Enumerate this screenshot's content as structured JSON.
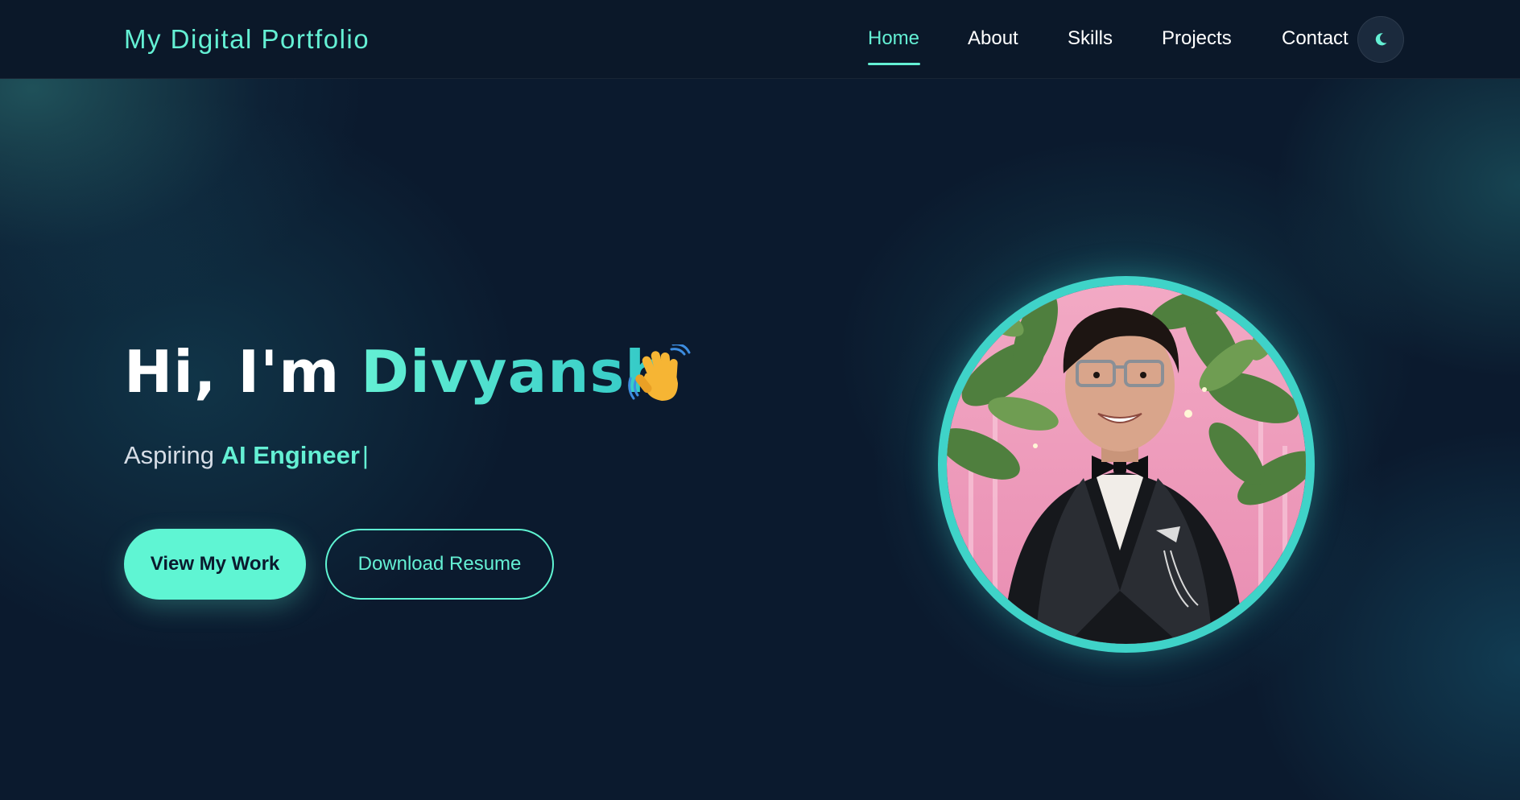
{
  "brand": {
    "title": "My Digital Portfolio"
  },
  "nav": {
    "items": [
      {
        "label": "Home",
        "active": true
      },
      {
        "label": "About",
        "active": false
      },
      {
        "label": "Skills",
        "active": false
      },
      {
        "label": "Projects",
        "active": false
      },
      {
        "label": "Contact",
        "active": false
      }
    ],
    "theme_toggle_icon": "moon-icon"
  },
  "hero": {
    "greeting": "Hi, I'm",
    "name": "Divyansh",
    "wave_icon": "waving-hand-icon",
    "subtitle_prefix": "Aspiring",
    "subtitle_role": "AI Engineer",
    "cursor": "|",
    "primary_button": "View My Work",
    "secondary_button": "Download Resume",
    "avatar": "profile-photo"
  },
  "colors": {
    "accent": "#64f0d4",
    "background": "#0b1a2e",
    "nav_background": "#0b1829",
    "avatar_ring": "#3fd3c8"
  }
}
